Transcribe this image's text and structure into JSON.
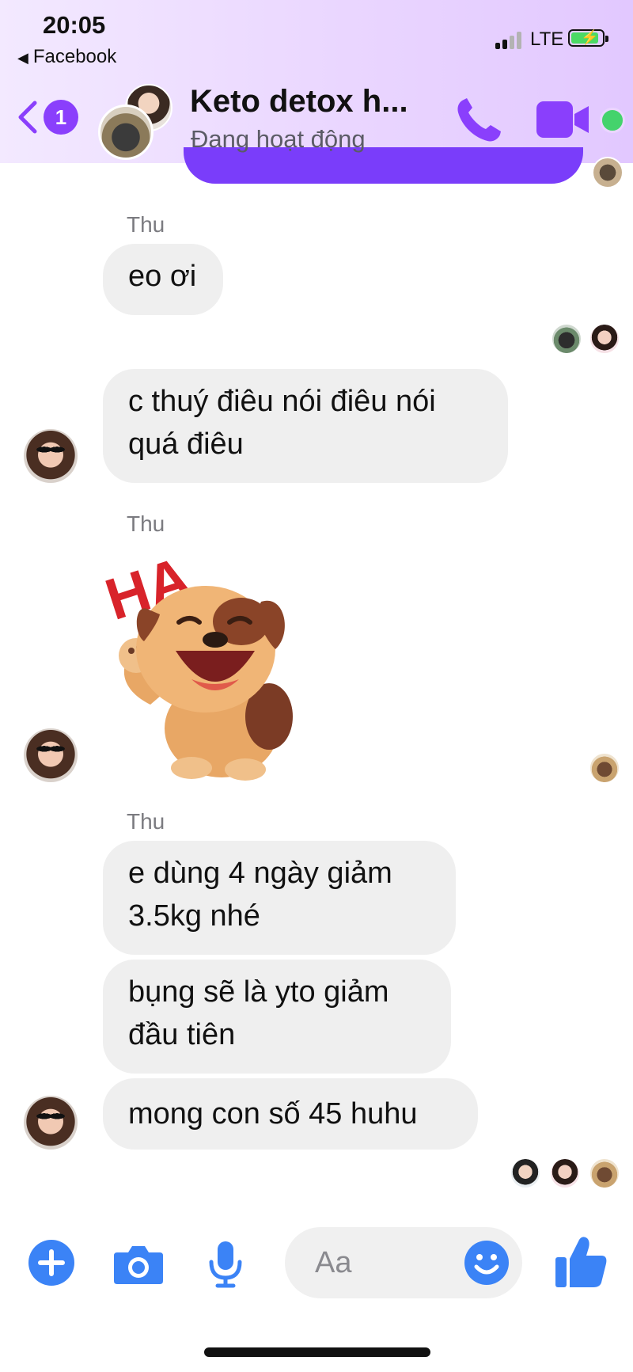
{
  "status_bar": {
    "time": "20:05",
    "back_app": "Facebook",
    "network": "LTE"
  },
  "header": {
    "back_count": "1",
    "title": "Keto detox h...",
    "subtitle": "Đang hoạt động",
    "accent_color": "#8a3ffc",
    "online_color": "#44d36c"
  },
  "messages": [
    {
      "sender": "Thu",
      "text": "eo ơi"
    },
    {
      "text": "c thuý điêu nói điêu nói quá điêu"
    },
    {
      "sender": "Thu",
      "sticker": "HA"
    },
    {
      "sender": "Thu",
      "text": "e dùng 4 ngày giảm 3.5kg nhé"
    },
    {
      "text": "bụng sẽ là yto giảm đầu tiên"
    },
    {
      "text": "mong con số 45 huhu"
    }
  ],
  "composer": {
    "placeholder": "Aa"
  },
  "icons": {
    "back": "chevron-left-icon",
    "call": "phone-icon",
    "video": "video-camera-icon",
    "plus": "plus-icon",
    "camera": "camera-icon",
    "mic": "microphone-icon",
    "emoji": "smiley-icon",
    "like": "thumbs-up-icon"
  }
}
